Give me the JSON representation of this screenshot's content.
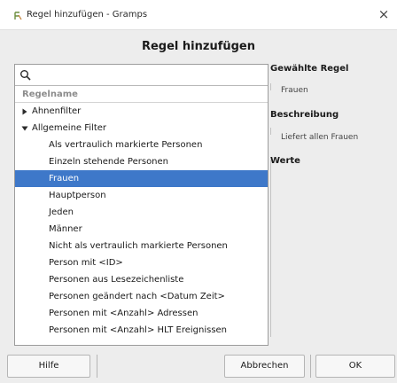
{
  "window": {
    "title": "Regel hinzufügen - Gramps",
    "close_glyph": "×",
    "app_icon": "gramps-app-icon"
  },
  "dialog": {
    "heading": "Regel hinzufügen"
  },
  "search": {
    "value": "",
    "placeholder": ""
  },
  "rule_list": {
    "column_header": "Regelname",
    "selected_color": "#3e78c9",
    "groups": [
      {
        "label": "Ahnenfilter",
        "expanded": false
      },
      {
        "label": "Allgemeine Filter",
        "expanded": true
      }
    ],
    "items": [
      "Als vertraulich markierte Personen",
      "Einzeln stehende Personen",
      "Frauen",
      "Hauptperson",
      "Jeden",
      "Männer",
      "Nicht als vertraulich markierte Personen",
      "Person mit <ID>",
      "Personen aus Lesezeichenliste",
      "Personen geändert nach <Datum Zeit>",
      "Personen mit <Anzahl> Adressen",
      "Personen mit <Anzahl> HLT Ereignissen"
    ],
    "selected_item": "Frauen"
  },
  "details": {
    "selected_rule_heading": "Gewählte Regel",
    "selected_rule_value": "Frauen",
    "description_heading": "Beschreibung",
    "description_value": "Liefert allen Frauen",
    "values_heading": "Werte"
  },
  "buttons": {
    "help": "Hilfe",
    "cancel": "Abbrechen",
    "ok": "OK"
  }
}
